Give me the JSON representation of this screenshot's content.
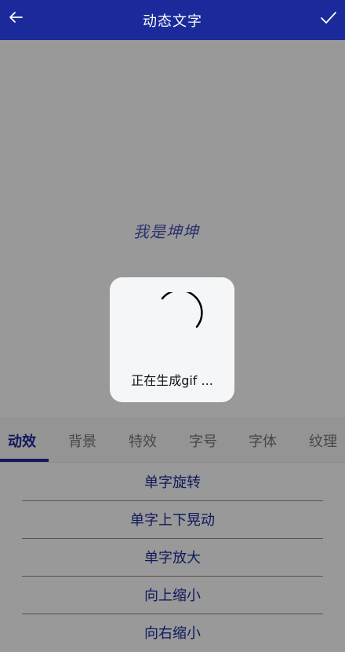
{
  "header": {
    "title": "动态文字"
  },
  "preview": {
    "text": "我是坤坤"
  },
  "tabs": [
    {
      "label": "动效",
      "active": true
    },
    {
      "label": "背景",
      "active": false
    },
    {
      "label": "特效",
      "active": false
    },
    {
      "label": "字号",
      "active": false
    },
    {
      "label": "字体",
      "active": false
    },
    {
      "label": "纹理",
      "active": false
    }
  ],
  "effects": [
    "单字旋转",
    "单字上下晃动",
    "单字放大",
    "向上缩小",
    "向右缩小"
  ],
  "dialog": {
    "text": "正在生成gif ..."
  },
  "icons": {
    "back": "back-arrow-icon",
    "confirm": "checkmark-icon",
    "keyboard": "keyboard-icon",
    "loading": "loading-spinner-icon"
  },
  "colors": {
    "header": "#1a2a9a",
    "accent": "#1a2a9a",
    "preview_text": "#4c56b8"
  }
}
